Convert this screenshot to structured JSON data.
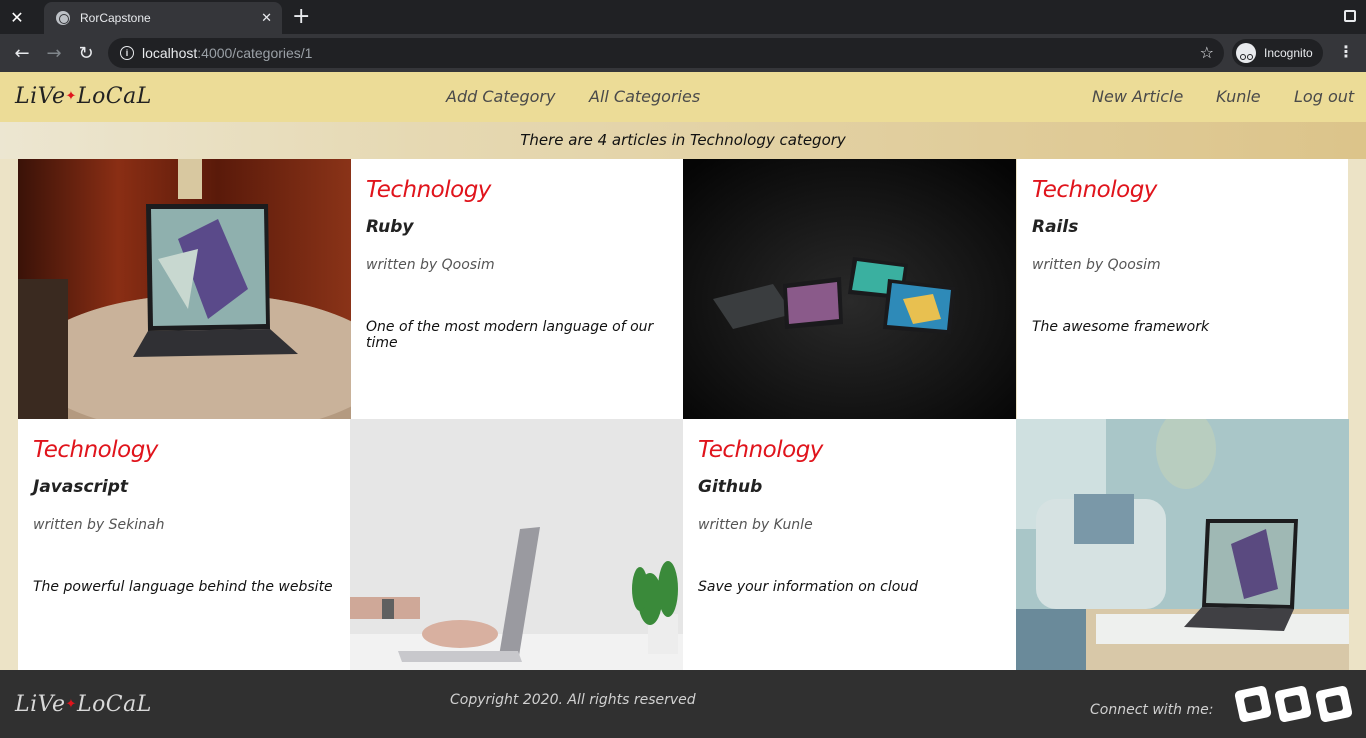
{
  "browser": {
    "tab_title": "RorCapstone",
    "url_host": "localhost",
    "url_path": ":4000/categories/1",
    "incognito_label": "Incognito"
  },
  "header": {
    "logo_left": "LiVe",
    "logo_right": "LoCaL",
    "nav": {
      "add_category": "Add Category",
      "all_categories": "All Categories",
      "new_article": "New Article",
      "user": "Kunle",
      "logout": "Log out"
    }
  },
  "banner": "There are 4 articles in Technology category",
  "articles": [
    {
      "category": "Technology",
      "title": "Ruby",
      "author": "written by Qoosim",
      "description": "One of the most modern language of our time"
    },
    {
      "category": "Technology",
      "title": "Rails",
      "author": "written by Qoosim",
      "description": "The awesome framework"
    },
    {
      "category": "Technology",
      "title": "Javascript",
      "author": "written by Sekinah",
      "description": "The powerful language behind the website"
    },
    {
      "category": "Technology",
      "title": "Github",
      "author": "written by Kunle",
      "description": "Save your information on cloud"
    }
  ],
  "footer": {
    "logo_left": "LiVe",
    "logo_right": "LoCaL",
    "copyright": "Copyright 2020. All rights reserved",
    "connect": "Connect with me:",
    "social_icons": [
      "social-icon-1",
      "social-icon-2",
      "social-icon-3"
    ]
  },
  "colors": {
    "header_bg": "#ecdc97",
    "accent_red": "#e0141c",
    "footer_bg": "#303030"
  }
}
